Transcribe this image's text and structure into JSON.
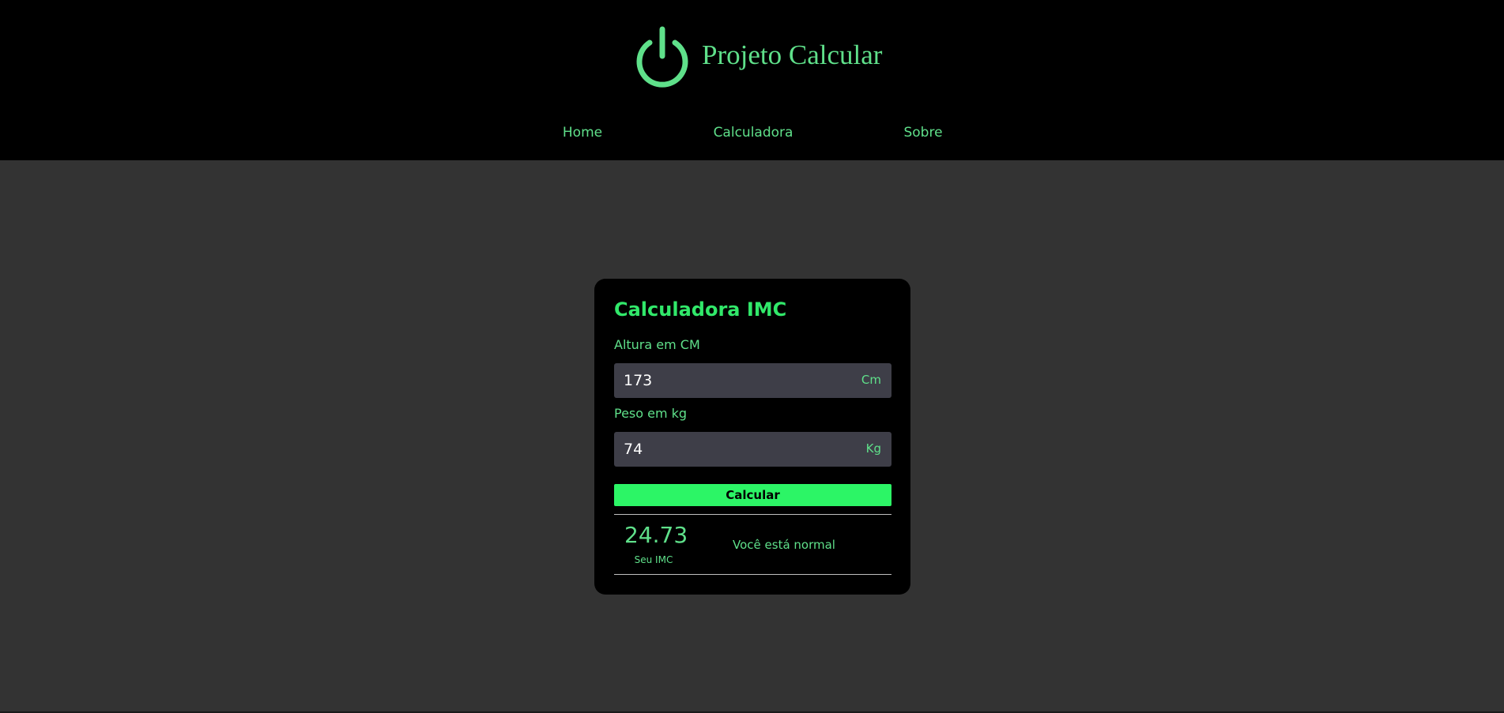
{
  "header": {
    "brand_icon": "power-icon",
    "brand_title": "Projeto Calcular",
    "nav": [
      {
        "label": "Home"
      },
      {
        "label": "Calculadora"
      },
      {
        "label": "Sobre"
      }
    ]
  },
  "calculator": {
    "title": "Calculadora IMC",
    "height_field": {
      "label": "Altura em CM",
      "value": "173",
      "unit": "Cm"
    },
    "weight_field": {
      "label": "Peso em kg",
      "value": "74",
      "unit": "Kg"
    },
    "button_label": "Calcular",
    "result": {
      "value": "24.73",
      "caption": "Seu IMC",
      "status": "Você está normal"
    }
  },
  "colors": {
    "header_background": "#000000",
    "page_background": "#333333",
    "accent_green": "#2cf566",
    "text_green": "#5fe08a",
    "input_background": "#3e3e48"
  }
}
